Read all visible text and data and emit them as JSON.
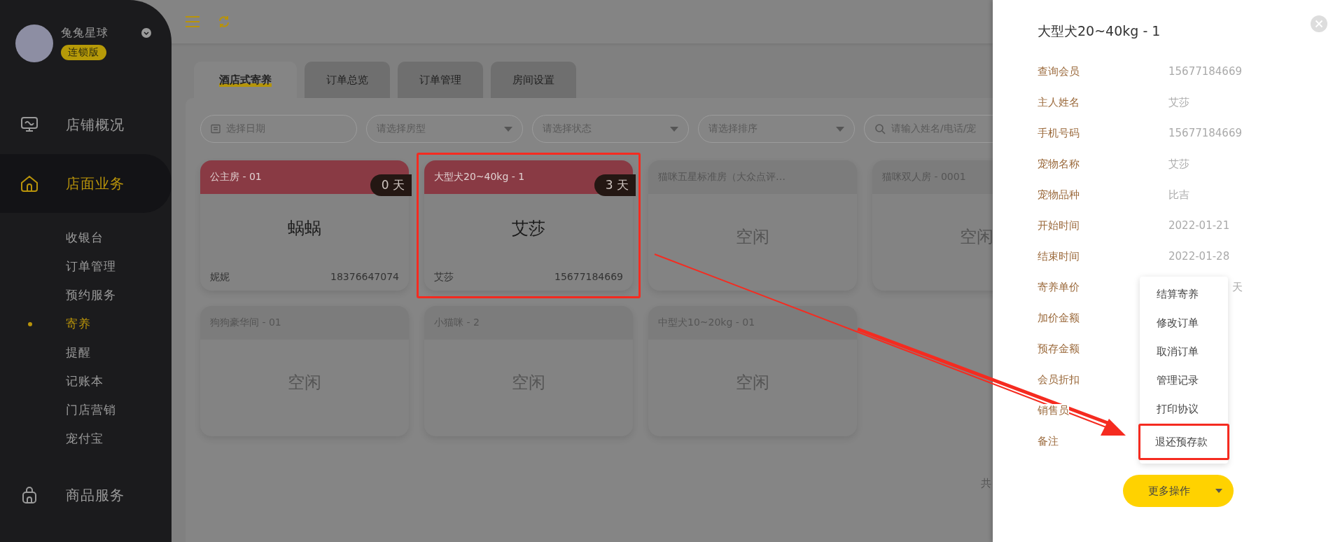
{
  "sidebar": {
    "store_name": "兔兔星球",
    "badge": "连锁版",
    "nav": [
      {
        "label": "店铺概况",
        "selected": false
      },
      {
        "label": "店面业务",
        "selected": true,
        "children": [
          {
            "label": "收银台",
            "selected": false
          },
          {
            "label": "订单管理",
            "selected": false
          },
          {
            "label": "预约服务",
            "selected": false
          },
          {
            "label": "寄养",
            "selected": true
          },
          {
            "label": "提醒",
            "selected": false
          },
          {
            "label": "记账本",
            "selected": false
          },
          {
            "label": "门店营销",
            "selected": false
          },
          {
            "label": "宠付宝",
            "selected": false
          }
        ]
      },
      {
        "label": "商品服务",
        "selected": false
      }
    ]
  },
  "tabs": [
    {
      "label": "酒店式寄养",
      "selected": true
    },
    {
      "label": "订单总览",
      "selected": false
    },
    {
      "label": "订单管理",
      "selected": false
    },
    {
      "label": "房间设置",
      "selected": false
    }
  ],
  "filters": [
    {
      "kind": "date",
      "placeholder": "选择日期"
    },
    {
      "kind": "select",
      "placeholder": "请选择房型"
    },
    {
      "kind": "select",
      "placeholder": "请选择状态"
    },
    {
      "kind": "select",
      "placeholder": "请选择排序"
    },
    {
      "kind": "search",
      "placeholder": "请输入姓名/电话/宠"
    }
  ],
  "rooms": [
    {
      "name": "公主房 - 01",
      "occupied": true,
      "highlighted": false,
      "days": "0 天",
      "pet": "蜗蜗",
      "owner": "妮妮",
      "phone": "18376647074"
    },
    {
      "name": "大型犬20~40kg - 1",
      "occupied": true,
      "highlighted": true,
      "days": "3 天",
      "pet": "艾莎",
      "owner": "艾莎",
      "phone": "15677184669"
    },
    {
      "name": "猫咪五星标准房（大众点评…",
      "occupied": false,
      "highlighted": false,
      "status": "空闲"
    },
    {
      "name": "猫咪双人房 - 0001",
      "occupied": false,
      "highlighted": false,
      "status": "空闲"
    },
    {
      "name": "狗狗豪华间 - 01",
      "occupied": false,
      "highlighted": false,
      "status": "空闲"
    },
    {
      "name": "小猫咪 - 2",
      "occupied": false,
      "highlighted": false,
      "status": "空闲"
    },
    {
      "name": "中型犬10~20kg - 01",
      "occupied": false,
      "highlighted": false,
      "status": "空闲"
    }
  ],
  "pager_text": "共",
  "drawer": {
    "title": "大型犬20~40kg - 1",
    "fields": [
      {
        "label": "查询会员",
        "value": "15677184669"
      },
      {
        "label": "主人姓名",
        "value": "艾莎"
      },
      {
        "label": "手机号码",
        "value": "15677184669"
      },
      {
        "label": "宠物名称",
        "value": "艾莎"
      },
      {
        "label": "宠物品种",
        "value": "比吉"
      },
      {
        "label": "开始时间",
        "value": "2022-01-21"
      },
      {
        "label": "结束时间",
        "value": "2022-01-28"
      },
      {
        "label": "寄养单价",
        "value": "天",
        "kind": "partial"
      },
      {
        "label": "加价金额"
      },
      {
        "label": "预存金额"
      },
      {
        "label": "会员折扣"
      },
      {
        "label": "销售员"
      },
      {
        "label": "备注"
      }
    ],
    "menu": [
      {
        "label": "结算寄养",
        "highlighted": false
      },
      {
        "label": "修改订单",
        "highlighted": false
      },
      {
        "label": "取消订单",
        "highlighted": false
      },
      {
        "label": "管理记录",
        "highlighted": false
      },
      {
        "label": "打印协议",
        "highlighted": false
      },
      {
        "label": "退还预存款",
        "highlighted": true
      }
    ],
    "button": "更多操作"
  }
}
